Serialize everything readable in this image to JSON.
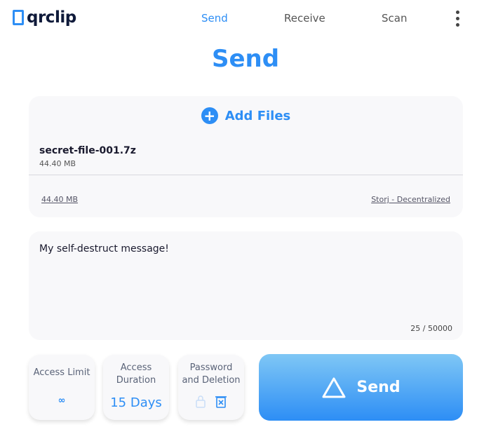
{
  "header": {
    "logo": "qrclip",
    "nav": [
      {
        "label": "Send",
        "active": true
      },
      {
        "label": "Receive"
      },
      {
        "label": "Scan"
      }
    ],
    "menu_icon": "kebab-menu-icon"
  },
  "page_title": "Send",
  "files": {
    "add_label": "Add Files",
    "items": [
      {
        "name": "secret-file-001.7z",
        "size": "44.40 MB"
      }
    ],
    "total_size": "44.40 MB",
    "storage": "Storj - Decentralized"
  },
  "message": {
    "value": "My self-destruct message!",
    "counter": "25 / 50000"
  },
  "options": {
    "access_limit": {
      "label": "Access Limit",
      "value": "∞"
    },
    "access_duration": {
      "label": "Access Duration",
      "value": "15 Days"
    },
    "password_deletion": {
      "label": "Password and Deletion"
    }
  },
  "send_button": {
    "label": "Send"
  },
  "colors": {
    "accent": "#2d8ef5"
  }
}
